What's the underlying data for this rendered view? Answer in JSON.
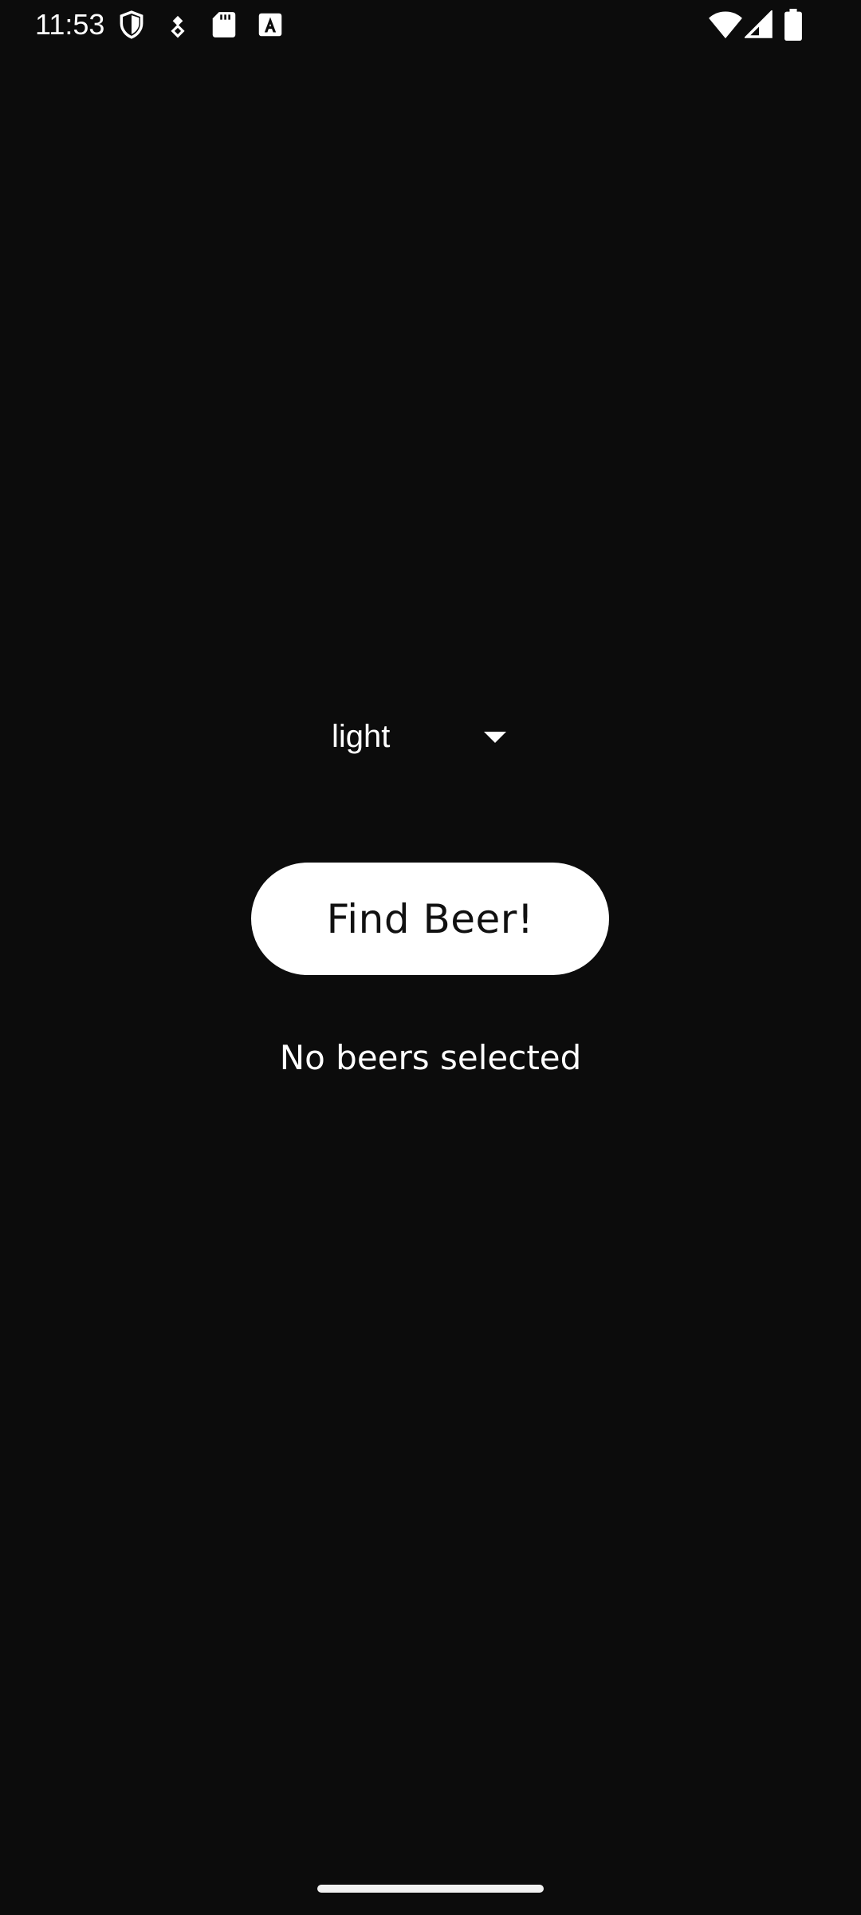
{
  "status_bar": {
    "time": "11:53",
    "left_icons": [
      "shield-icon",
      "location-pin-icon",
      "sd-card-icon",
      "font-a-icon"
    ],
    "right_icons": [
      "wifi-icon",
      "cellular-signal-icon",
      "battery-icon"
    ]
  },
  "dropdown": {
    "selected_value": "light",
    "arrow_icon": "triangle-down-icon"
  },
  "find_button": {
    "label": "Find Beer!"
  },
  "result": {
    "text": "No beers selected"
  },
  "colors": {
    "background": "#0c0c0c",
    "button_background": "#ffffff",
    "button_text": "#111111",
    "text": "#ffffff"
  }
}
